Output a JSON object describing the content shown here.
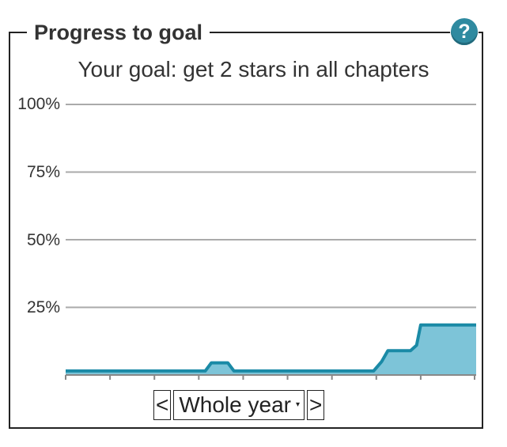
{
  "widget": {
    "title": "Progress to goal",
    "help_label": "?",
    "goal_text": "Your goal: get 2 stars in all chapters"
  },
  "chart_data": {
    "type": "area",
    "ylim": [
      0,
      100
    ],
    "y_ticks": [
      "100%",
      "75%",
      "50%",
      "25%"
    ],
    "grid": true,
    "x_tick_count": 10,
    "series": [
      {
        "x": [
          0,
          34,
          35.5,
          39.5,
          41,
          75,
          77,
          78.5,
          84,
          85.5,
          86.5,
          100
        ],
        "values": [
          1.5,
          1.5,
          4.5,
          4.5,
          1.5,
          1.5,
          5,
          9,
          9,
          11,
          18.5,
          18.5
        ]
      }
    ],
    "colors": {
      "line": "#1a8aa6",
      "fill": "#7dc4d8",
      "grid": "#aaaaaa",
      "axis": "#888888"
    }
  },
  "controls": {
    "prev_label": "<",
    "range_label": "Whole year",
    "caret": "▾",
    "next_label": ">"
  }
}
